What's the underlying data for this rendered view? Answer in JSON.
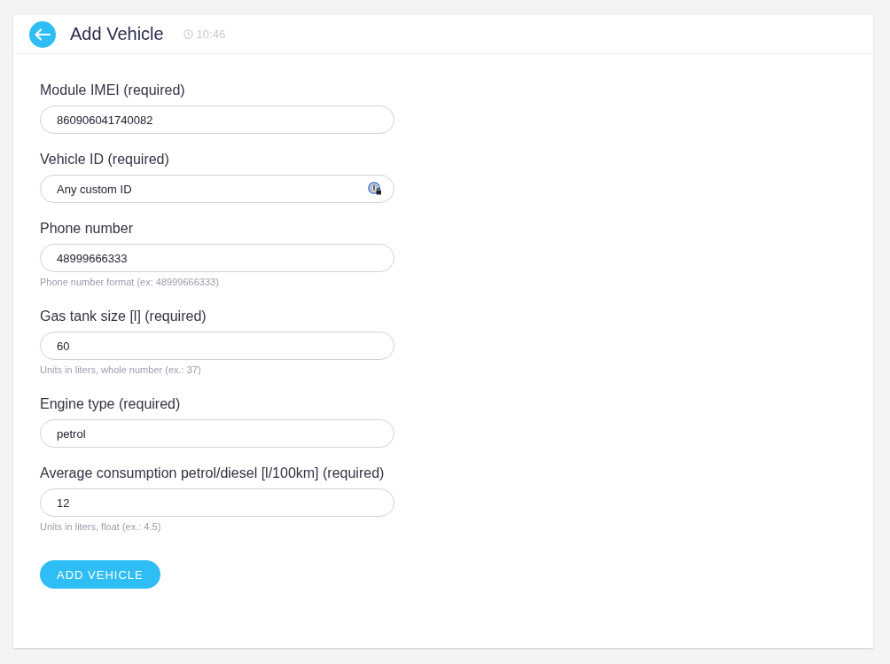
{
  "header": {
    "title": "Add Vehicle",
    "time": "10:46"
  },
  "fields": [
    {
      "label": "Module IMEI (required)",
      "value": "860906041740082"
    },
    {
      "label": "Vehicle ID (required)",
      "value": "Any custom ID",
      "kind": "password-manager"
    },
    {
      "label": "Phone number",
      "value": "48999666333",
      "hint": "Phone number format (ex: 48999666333)"
    },
    {
      "label": "Gas tank size [l] (required)",
      "value": "60",
      "hint": "Units in liters, whole number (ex.: 37)"
    },
    {
      "label": "Engine type (required)",
      "value": "petrol"
    },
    {
      "label": "Average consumption petrol/diesel [l/100km] (required)",
      "value": "12",
      "hint": "Units in liters, float (ex.: 4.5)"
    }
  ],
  "submit": "ADD VEHICLE"
}
